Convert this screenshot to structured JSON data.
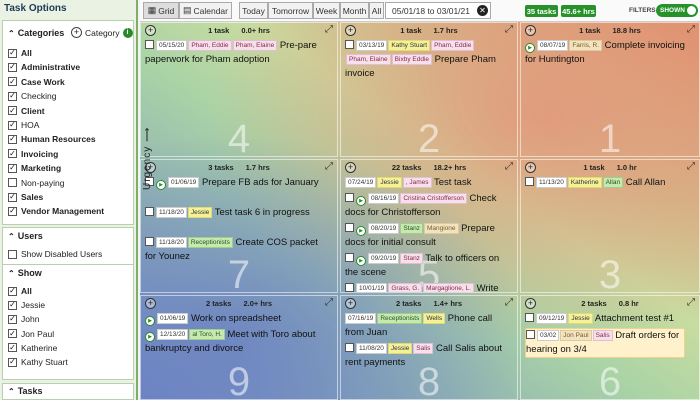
{
  "sidebar": {
    "title": "Task Options",
    "categories": {
      "header": "Categories",
      "add_label": "Category",
      "info_icon": "i",
      "items": [
        {
          "label": "All",
          "checked": true,
          "bold": true
        },
        {
          "label": "Administrative",
          "checked": true,
          "bold": true
        },
        {
          "label": "Case Work",
          "checked": true,
          "bold": true
        },
        {
          "label": "Checking",
          "checked": true,
          "bold": false
        },
        {
          "label": "Client",
          "checked": true,
          "bold": true
        },
        {
          "label": "HOA",
          "checked": true,
          "bold": false
        },
        {
          "label": "Human Resources",
          "checked": true,
          "bold": true
        },
        {
          "label": "Invoicing",
          "checked": true,
          "bold": true
        },
        {
          "label": "Marketing",
          "checked": true,
          "bold": true
        },
        {
          "label": "Non-paying",
          "checked": false,
          "bold": false
        },
        {
          "label": "Sales",
          "checked": true,
          "bold": true
        },
        {
          "label": "Vendor Management",
          "checked": true,
          "bold": true
        }
      ]
    },
    "users": {
      "header": "Users",
      "items": [
        {
          "label": "Show Disabled Users",
          "checked": false
        }
      ]
    },
    "show": {
      "header": "Show",
      "items": [
        {
          "label": "All",
          "checked": true,
          "bold": true
        },
        {
          "label": "Jessie",
          "checked": true,
          "bold": false
        },
        {
          "label": "John",
          "checked": true,
          "bold": false
        },
        {
          "label": "Jon Paul",
          "checked": true,
          "bold": false
        },
        {
          "label": "Katherine",
          "checked": true,
          "bold": false
        },
        {
          "label": "Kathy Stuart",
          "checked": true,
          "bold": false
        }
      ]
    },
    "tasks_header": "Tasks"
  },
  "toolbar": {
    "grid_label": "Grid",
    "calendar_label": "Calendar",
    "tabs": [
      "Today",
      "Tomorrow",
      "Week",
      "Month",
      "All"
    ],
    "date_range": "05/01/18 to 03/01/21",
    "task_count": "35 tasks",
    "hours": "45.6+ hrs",
    "filters_label": "FILTERS",
    "filters_toggle": "SHOWN"
  },
  "axis_label": "Urgency",
  "cells": [
    {
      "number": "4",
      "tasks": "1 task",
      "hours": "0.0+ hrs",
      "items": [
        {
          "date": "05/15/20",
          "users": [
            [
              "Pham, Eddie",
              "p"
            ],
            [
              "Pham, Elaine",
              "p"
            ]
          ],
          "title": "Pre-pare paperwork for Pham adoption",
          "checkbox": true,
          "play": false
        }
      ]
    },
    {
      "number": "2",
      "tasks": "1 task",
      "hours": "1.7 hrs",
      "items": [
        {
          "date": "03/13/19",
          "users": [
            [
              "Kathy Stuart",
              "y"
            ],
            [
              "Pham, Eddie",
              "p"
            ],
            [
              "Pham, Elaine",
              "p"
            ],
            [
              "Bixby Eddie",
              "p"
            ]
          ],
          "title": "Prepare Pham invoice",
          "checkbox": true,
          "play": false
        }
      ]
    },
    {
      "number": "1",
      "tasks": "1 task",
      "hours": "18.8 hrs",
      "items": [
        {
          "date": "08/07/19",
          "users": [
            [
              "Farris, R.",
              "o"
            ]
          ],
          "title": "Complete invoicing for Huntington",
          "checkbox": false,
          "play": true
        }
      ]
    },
    {
      "number": "7",
      "tasks": "3 tasks",
      "hours": "1.7 hrs",
      "items": [
        {
          "date": "01/06/19",
          "users": [],
          "title": "Prepare FB ads for January",
          "checkbox": true,
          "play": true
        },
        {
          "date": "11/18/20",
          "users": [
            [
              "Jessie",
              "y"
            ]
          ],
          "title": "Test task 6 in progress",
          "checkbox": true,
          "play": false
        },
        {
          "date": "11/18/20",
          "users": [
            [
              "Receptionists",
              "g"
            ]
          ],
          "title": "Create COS packet for Younez",
          "checkbox": true,
          "play": false
        }
      ]
    },
    {
      "number": "5",
      "tasks": "22 tasks",
      "hours": "18.2+ hrs",
      "items": [
        {
          "date": "07/24/19",
          "users": [
            [
              "Jessie",
              "y"
            ],
            [
              ", James",
              "p"
            ]
          ],
          "title": "Test task",
          "checkbox": false,
          "play": false
        },
        {
          "date": "08/16/19",
          "users": [
            [
              "Cristina Cristofferson",
              "p"
            ]
          ],
          "title": "Check docs for Christofferson",
          "checkbox": true,
          "play": true
        },
        {
          "date": "08/20/19",
          "users": [
            [
              "Stanz",
              "g"
            ],
            [
              "Mangione",
              "o"
            ]
          ],
          "title": "Prepare docs for initial consult",
          "checkbox": true,
          "play": true
        },
        {
          "date": "09/20/19",
          "users": [
            [
              "Stanz",
              "p"
            ]
          ],
          "title": "Talk to officers on the scene",
          "checkbox": true,
          "play": true
        },
        {
          "date": "10/01/19",
          "users": [
            [
              "Grass, G.",
              "p"
            ],
            [
              "Margaglione, L.",
              "p"
            ]
          ],
          "title": "Write",
          "checkbox": true,
          "play": false
        }
      ]
    },
    {
      "number": "3",
      "tasks": "1 task",
      "hours": "1.0 hr",
      "items": [
        {
          "date": "11/13/20",
          "users": [
            [
              "Katherine",
              "y"
            ],
            [
              "Allan",
              "g"
            ]
          ],
          "title": "Call Allan",
          "checkbox": true,
          "play": false
        }
      ]
    },
    {
      "number": "9",
      "tasks": "2 tasks",
      "hours": "2.0+ hrs",
      "items": [
        {
          "date": "01/06/19",
          "users": [],
          "title": "Work on spreadsheet",
          "checkbox": false,
          "play": true
        },
        {
          "date": "12/13/20",
          "users": [
            [
              "al Toro, H.",
              "g"
            ]
          ],
          "title": "Meet with Toro about bankruptcy and divorce",
          "checkbox": false,
          "play": true
        }
      ]
    },
    {
      "number": "8",
      "tasks": "2 tasks",
      "hours": "1.4+ hrs",
      "items": [
        {
          "date": "07/16/19",
          "users": [
            [
              "Receptionists",
              "g"
            ],
            [
              "Wells",
              "y"
            ]
          ],
          "title": "Phone call from Juan",
          "checkbox": false,
          "play": false
        },
        {
          "date": "11/08/20",
          "users": [
            [
              "Jessie",
              "y"
            ],
            [
              "Salis",
              "p"
            ]
          ],
          "title": "Call Salis about rent payments",
          "checkbox": true,
          "play": false
        }
      ]
    },
    {
      "number": "6",
      "tasks": "2 tasks",
      "hours": "0.8 hr",
      "items": [
        {
          "date": "09/12/19",
          "users": [
            [
              "Jessie",
              "y"
            ]
          ],
          "title": "Attachment test #1",
          "checkbox": true,
          "play": false
        },
        {
          "date": "03/02",
          "users": [
            [
              "Jon Paul",
              "o"
            ],
            [
              "Salis",
              "p"
            ]
          ],
          "title": "Draft orders for hearing on 3/4",
          "checkbox": true,
          "play": false
        }
      ]
    }
  ],
  "colors": {
    "brand_green": "#27922a",
    "sidebar_bg": "#e9f2e3"
  }
}
